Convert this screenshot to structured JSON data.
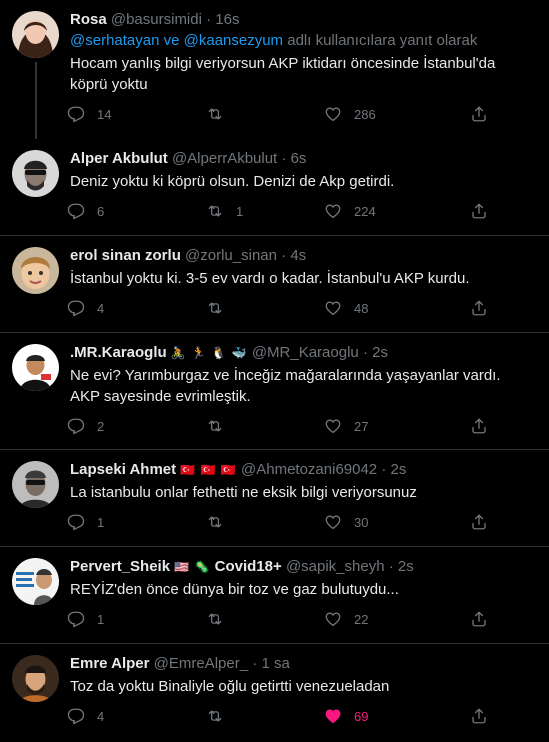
{
  "tweets": [
    {
      "name": "Rosa",
      "handle": "@basursimidi",
      "time": "16s",
      "reply_mentions": "@serhatayan ve @kaansezyum",
      "reply_suffix": "adlı kullanıcılara yanıt olarak",
      "text": "Hocam yanlış bilgi veriyorsun AKP iktidarı öncesinde İstanbul'da köprü yoktu",
      "replies": "14",
      "retweets": "",
      "likes": "286",
      "liked": false
    },
    {
      "name": "Alper Akbulut",
      "handle": "@AlperrAkbulut",
      "time": "6s",
      "text": "Deniz yoktu ki köprü olsun. Denizi de Akp getirdi.",
      "replies": "6",
      "retweets": "1",
      "likes": "224",
      "liked": false
    },
    {
      "name": "erol sinan zorlu",
      "handle": "@zorlu_sinan",
      "time": "4s",
      "text": "İstanbul yoktu ki. 3-5 ev vardı o kadar. İstanbul'u AKP kurdu.",
      "replies": "4",
      "retweets": "",
      "likes": "48",
      "liked": false
    },
    {
      "name": ".MR.Karaoglu",
      "emoji": "🚴 🏃 🐧 🐳",
      "handle": "@MR_Karaoglu",
      "time": "2s",
      "text": "Ne evi? Yarımburgaz ve İnceğiz mağaralarında yaşayanlar vardı. AKP sayesinde evrimleştik.",
      "replies": "2",
      "retweets": "",
      "likes": "27",
      "liked": false
    },
    {
      "name": "Lapseki Ahmet",
      "emoji": "🇹🇷 🇹🇷 🇹🇷",
      "handle": "@Ahmetozani69042",
      "time": "2s",
      "text": "La istanbulu onlar fethetti ne eksik bilgi veriyorsunuz",
      "replies": "1",
      "retweets": "",
      "likes": "30",
      "liked": false
    },
    {
      "name": "Pervert_Sheik",
      "emoji": "🇺🇸 🦠",
      "name2": "Covid18+",
      "handle": "@sapik_sheyh",
      "time": "2s",
      "text": "REYİZ'den önce dünya bir toz ve gaz bulutuydu...",
      "replies": "1",
      "retweets": "",
      "likes": "22",
      "liked": false
    },
    {
      "name": "Emre Alper",
      "handle": "@EmreAlper_",
      "time": "1 sa",
      "text": "Toz da yoktu Binaliyle oğlu getirtti venezueladan",
      "replies": "4",
      "retweets": "",
      "likes": "69",
      "liked": true
    }
  ],
  "colors": {
    "accent": "#1d9bf0",
    "like": "#f91880",
    "muted": "#71767b"
  },
  "icons": [
    "reply-icon",
    "retweet-icon",
    "like-icon",
    "share-icon"
  ]
}
